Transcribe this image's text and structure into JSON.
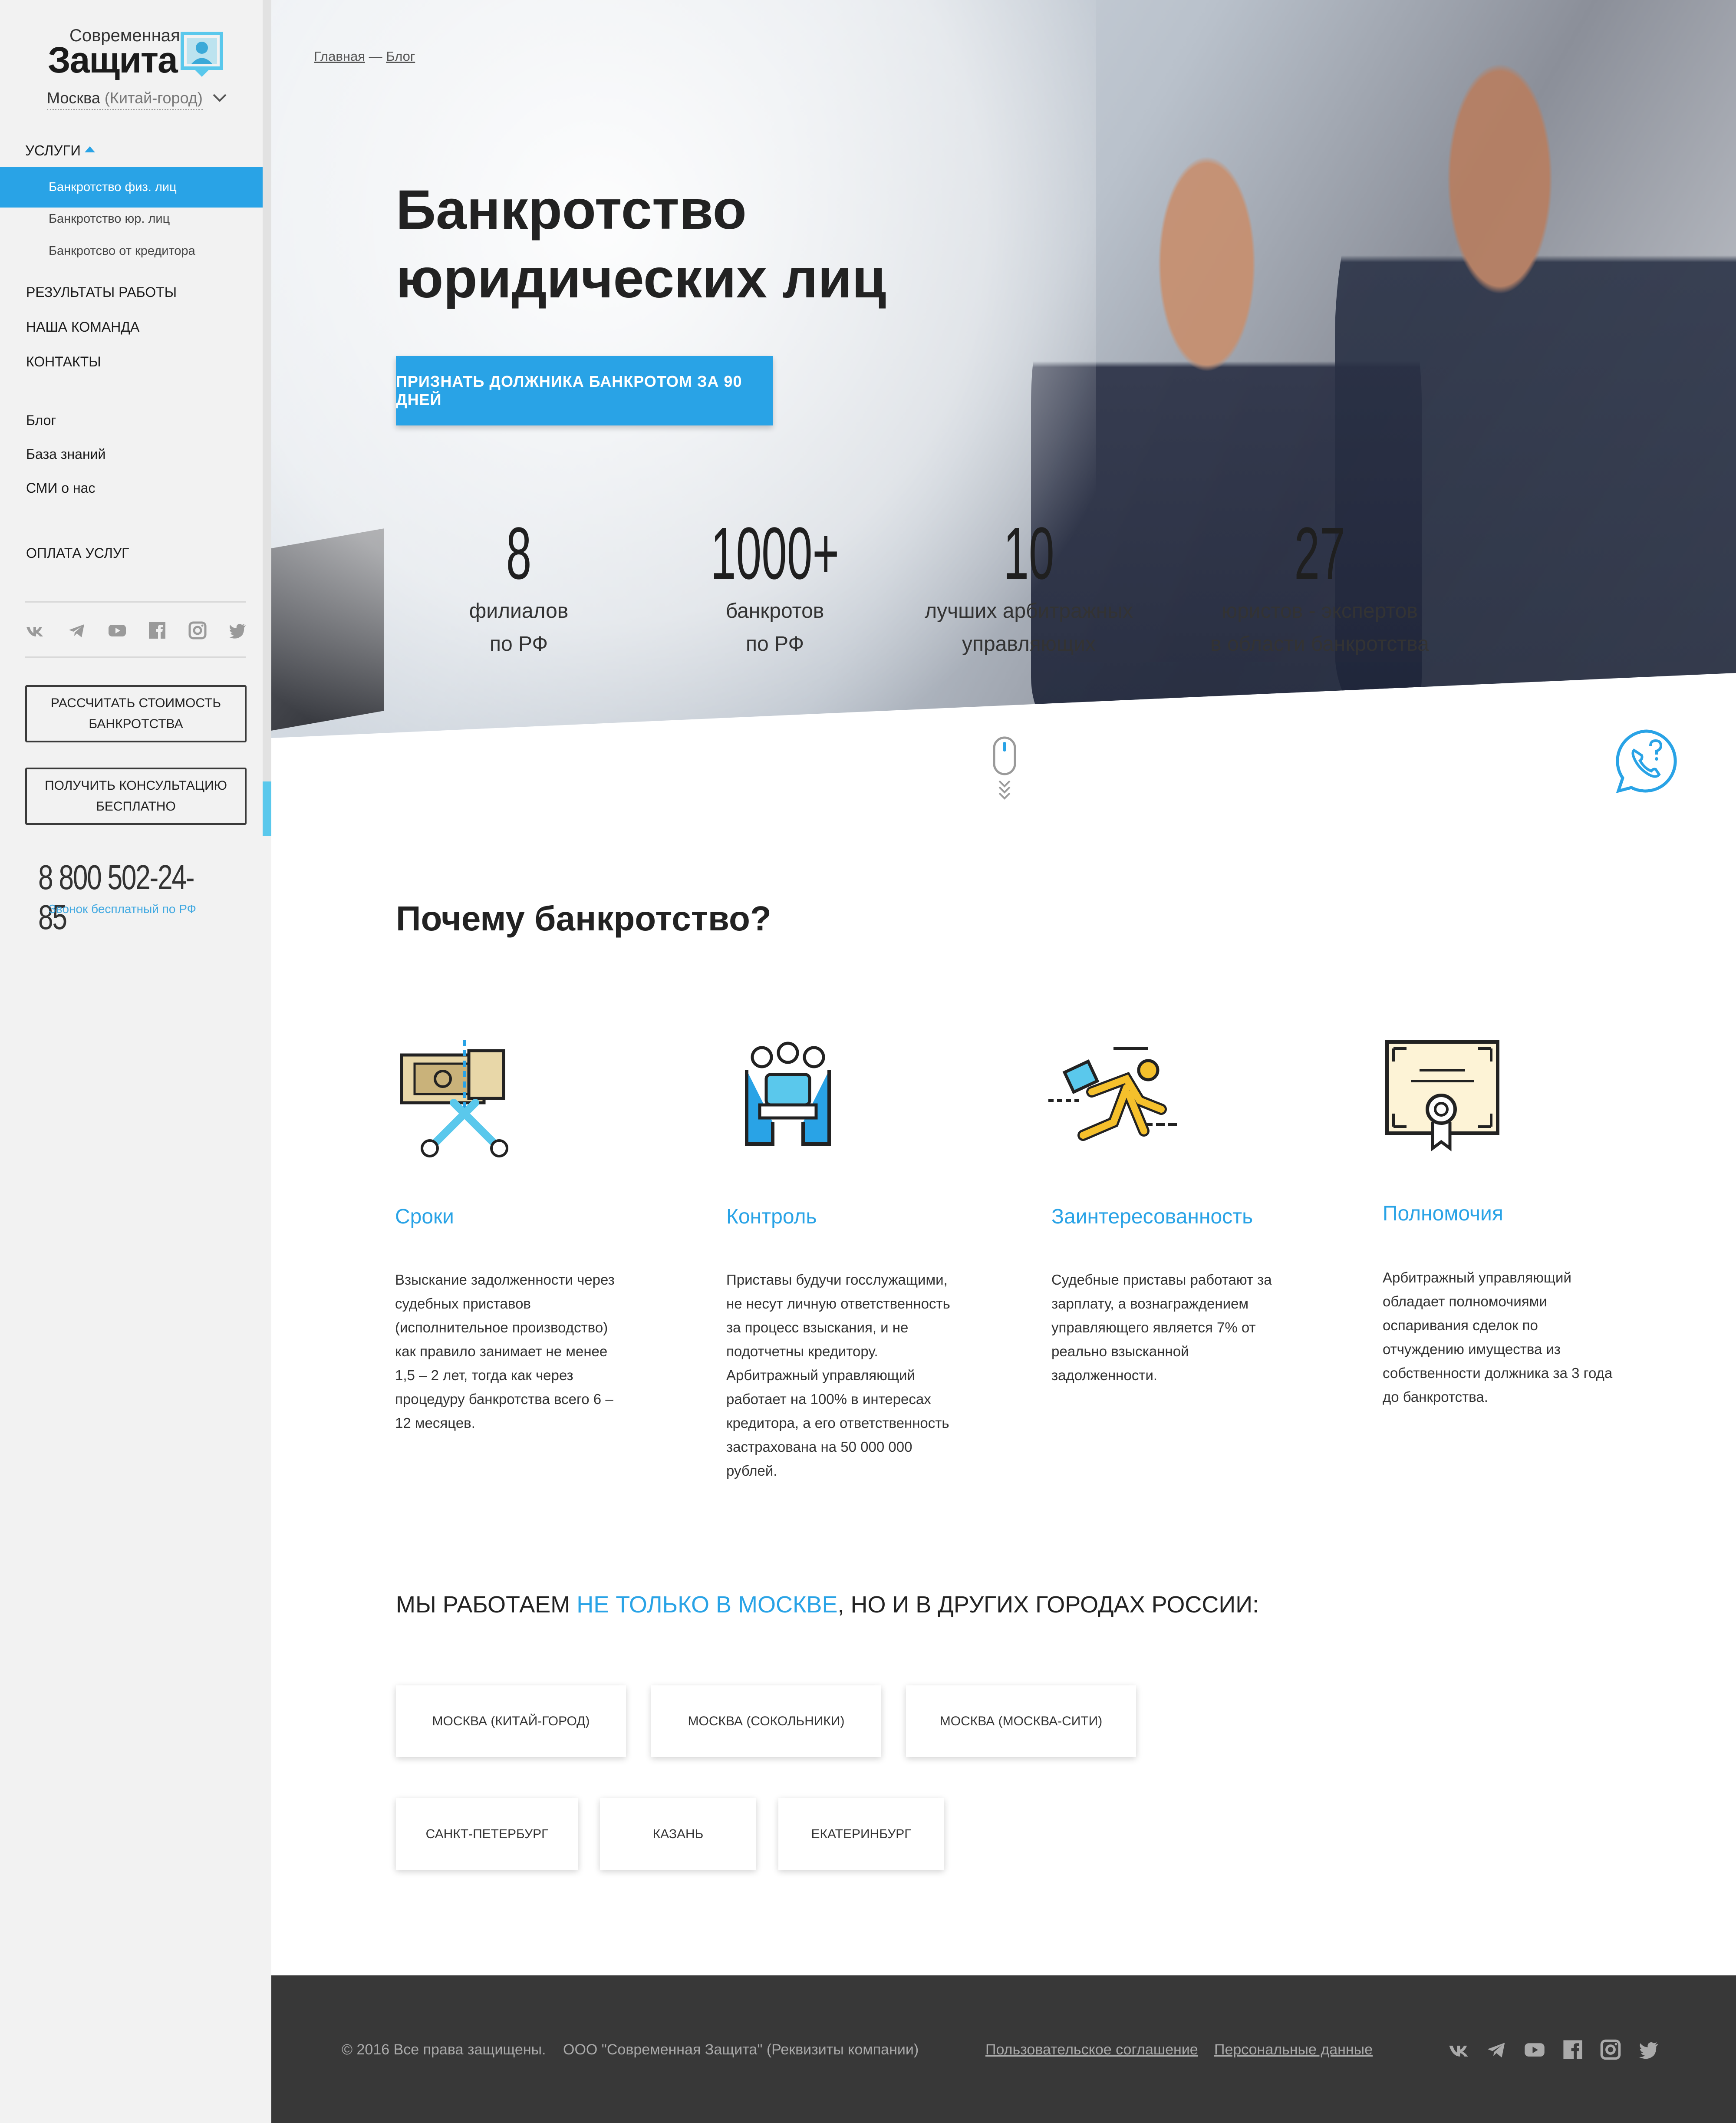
{
  "sidebar": {
    "logo_top": "Современная",
    "logo_main": "Защита",
    "city_main": "Москва",
    "city_paren": "(Китай-город)",
    "services_label": "УСЛУГИ",
    "sub_items": [
      "Банкротство физ. лиц",
      "Банкротство юр. лиц",
      "Банкротсво от кредитора"
    ],
    "nav_items": [
      "РЕЗУЛЬТАТЫ РАБОТЫ",
      "НАША КОМАНДА",
      "КОНТАКТЫ"
    ],
    "extra_items": [
      "Блог",
      "База знаний",
      "СМИ о нас"
    ],
    "payment": "ОПЛАТА УСЛУГ",
    "social": [
      "vk-icon",
      "telegram-icon",
      "youtube-icon",
      "facebook-icon",
      "instagram-icon",
      "twitter-icon"
    ],
    "btn_calc_line1": "РАССЧИТАТЬ СТОИМОСТЬ",
    "btn_calc_line2": "БАНКРОТСТВА",
    "btn_consult_line1": "ПОЛУЧИТЬ КОНСУЛЬТАЦИЮ",
    "btn_consult_line2": "БЕСПЛАТНО",
    "phone": "8 800 502-24-85",
    "phone_note": "Звонок бесплатный по РФ"
  },
  "hero": {
    "breadcrumb_home": "Главная",
    "breadcrumb_sep": " — ",
    "breadcrumb_current": "Блог",
    "title_line1": "Банкротство",
    "title_line2": "юридических лиц",
    "cta": "ПРИЗНАТЬ ДОЛЖНИКА БАНКРОТОМ ЗА 90 ДНЕЙ",
    "stats": [
      {
        "num": "8",
        "line1": "филиалов",
        "line2": "по РФ"
      },
      {
        "num": "1000+",
        "line1": "банкротов",
        "line2": "по РФ"
      },
      {
        "num": "10",
        "line1": "лучших арбитражных",
        "line2": "управляющих"
      },
      {
        "num": "27",
        "line1": "юристов - экспертов",
        "line2": "в области банкротства"
      }
    ]
  },
  "why": {
    "title": "Почему банкротство?",
    "features": [
      {
        "icon": "money-scissors-icon",
        "title": "Сроки",
        "text": "Взыскание задолженности через судебных приставов (исполнительное производство) как правило занимает не менее 1,5 – 2 лет, тогда как через процедуру банкротства всего 6 – 12 месяцев."
      },
      {
        "icon": "meeting-table-icon",
        "title": "Контроль",
        "text": "Приставы будучи госслужащими, не несут личную ответственность за процесс взыскания, и не подотчетны кредитору. Арбитражный управляющий работает на 100% в интересах кредитора, а его ответственность застрахована на 50 000 000 рублей."
      },
      {
        "icon": "running-man-icon",
        "title": "Заинтересованность",
        "text": "Судебные приставы работают за зарплату, а вознаграждением управляющего является 7% от реально взысканной задолженности."
      },
      {
        "icon": "certificate-icon",
        "title": "Полномочия",
        "text": "Арбитражный управляющий обладает полномочиями оспаривания сделок по отчуждению имущества из собственности должника за 3 года до банкротства."
      }
    ]
  },
  "cities": {
    "title_pre": "МЫ РАБОТАЕМ ",
    "title_hl": "НЕ ТОЛЬКО В МОСКВЕ",
    "title_post": ", НО И В ДРУГИХ ГОРОДАХ РОССИИ:",
    "list": [
      "МОСКВА (КИТАЙ-ГОРОД)",
      "МОСКВА (СОКОЛЬНИКИ)",
      "МОСКВА (МОСКВА-СИТИ)",
      "САНКТ-ПЕТЕРБУРГ",
      "КАЗАНЬ",
      "ЕКАТЕРИНБУРГ"
    ]
  },
  "footer": {
    "copyright": "© 2016 Все права защищены.",
    "company": "ООО \"Современная Защита\" (Реквизиты компании)",
    "link_terms": "Пользовательское соглашение",
    "link_personal": "Персональные данные"
  },
  "colors": {
    "accent": "#29a3e6",
    "sidebar_bg": "#f2f2f2",
    "footer_bg": "#383838"
  }
}
